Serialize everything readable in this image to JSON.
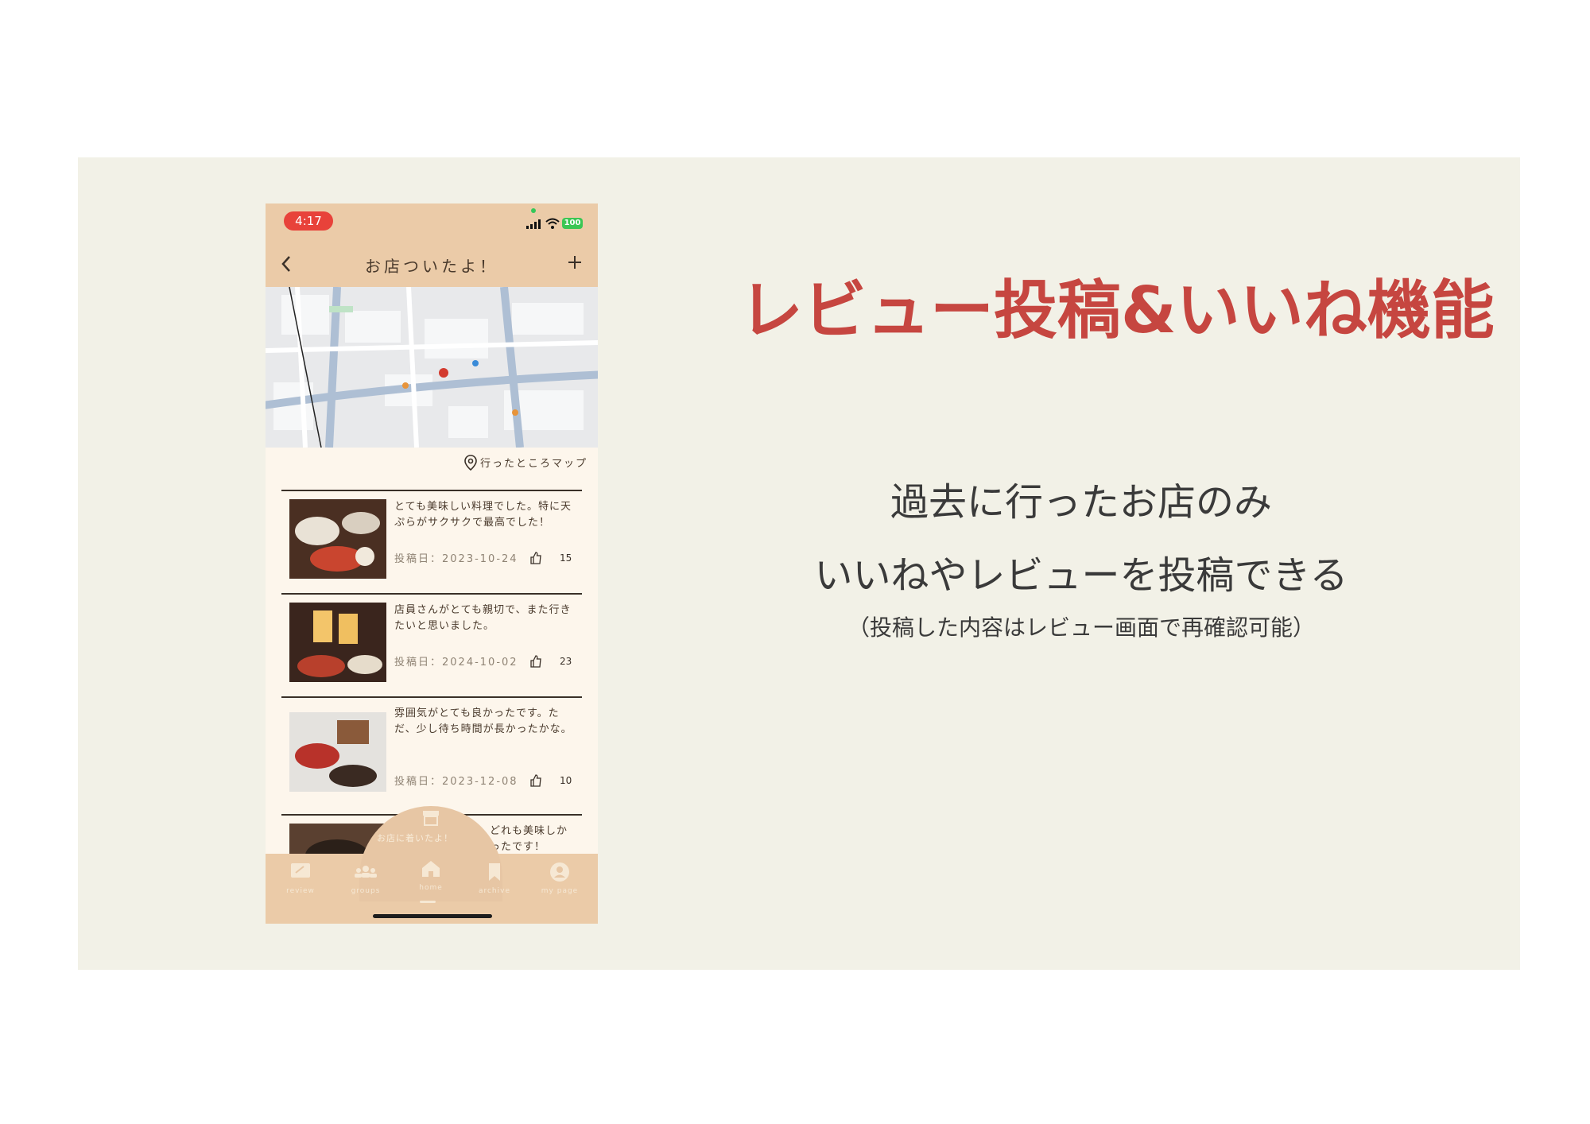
{
  "slide": {
    "headline": "レビュー投稿&いいね機能",
    "body_line1": "過去に行ったお店のみ",
    "body_line2": "いいねやレビューを投稿できる",
    "note": "（投稿した内容はレビュー画面で再確認可能）"
  },
  "phone": {
    "status": {
      "time": "4:17",
      "battery": "100"
    },
    "nav": {
      "title": "お店ついたよ！"
    },
    "map_link": "行ったところマップ",
    "reviews": [
      {
        "text": "とても美味しい料理でした。特に天ぷらがサクサクで最高でした！",
        "date": "投稿日：2023-10-24",
        "likes": "15"
      },
      {
        "text": "店員さんがとても親切で、また行きたいと思いました。",
        "date": "投稿日：2024-10-02",
        "likes": "23"
      },
      {
        "text": "雰囲気がとても良かったです。ただ、少し待ち時間が長かったかな。",
        "date": "投稿日：2023-12-08",
        "likes": "10"
      },
      {
        "text": "どれも美味しかったです！",
        "date": "",
        "likes": ""
      }
    ],
    "hump_label": "お店に着いたよ！",
    "tabs": [
      {
        "label": "review"
      },
      {
        "label": "groups"
      },
      {
        "label": "home"
      },
      {
        "label": "archive"
      },
      {
        "label": "my page"
      }
    ]
  },
  "colors": {
    "accent": "#c64640",
    "panel": "#f2f1e7",
    "phone_header": "#ebcba8"
  }
}
